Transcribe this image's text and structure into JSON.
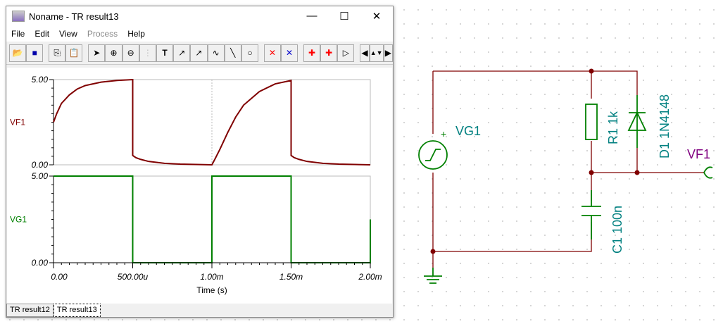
{
  "window": {
    "title": "Noname - TR result13",
    "min": "—",
    "max": "☐",
    "close": "✕"
  },
  "menu": [
    "File",
    "Edit",
    "View",
    "Process",
    "Help"
  ],
  "toolbar": [
    "open",
    "save",
    "copy",
    "paste",
    "pointer",
    "zoom-in",
    "zoom-out",
    "grid",
    "text",
    "cursor-a",
    "cursor-b",
    "wave",
    "line",
    "circle",
    "cursor-a-red",
    "cursor-b-blue",
    "add-curve",
    "add-probe",
    "arrow",
    "left",
    "up-down",
    "right"
  ],
  "tabs": [
    "TR result12",
    "TR result13"
  ],
  "chart_data": [
    {
      "type": "line",
      "title": "",
      "ylabel": "VF1",
      "xlabel": "Time (s)",
      "ylim": [
        0,
        5
      ],
      "xlim": [
        0,
        2
      ],
      "yticks": [
        "5.00",
        "0.00"
      ],
      "xticks": [
        "0.00",
        "500.00u",
        "1.00m",
        "1.50m",
        "2.00m"
      ],
      "color": "#800000",
      "x": [
        0,
        0.02,
        0.05,
        0.1,
        0.15,
        0.2,
        0.3,
        0.4,
        0.5,
        0.5,
        0.52,
        0.55,
        0.6,
        0.7,
        0.8,
        0.9,
        1.0,
        1.02,
        1.05,
        1.1,
        1.15,
        1.2,
        1.3,
        1.4,
        1.5,
        1.5,
        1.52,
        1.55,
        1.6,
        1.7,
        1.8,
        1.9,
        2.0
      ],
      "y": [
        2.5,
        3.0,
        3.6,
        4.1,
        4.45,
        4.65,
        4.85,
        4.95,
        5.0,
        0.55,
        0.42,
        0.32,
        0.2,
        0.09,
        0.04,
        0.02,
        0.0,
        0.35,
        0.9,
        1.9,
        2.8,
        3.5,
        4.3,
        4.75,
        4.95,
        0.55,
        0.42,
        0.32,
        0.2,
        0.09,
        0.04,
        0.02,
        0.0
      ]
    },
    {
      "type": "line",
      "title": "",
      "ylabel": "VG1",
      "xlabel": "Time (s)",
      "ylim": [
        0,
        5
      ],
      "xlim": [
        0,
        2
      ],
      "yticks": [
        "5.00",
        "0.00"
      ],
      "xticks": [
        "0.00",
        "500.00u",
        "1.00m",
        "1.50m",
        "2.00m"
      ],
      "color": "#008000",
      "x": [
        0,
        0.5,
        0.5,
        1.0,
        1.0,
        1.5,
        1.5,
        2.0,
        2.0
      ],
      "y": [
        5,
        5,
        0,
        0,
        5,
        5,
        0,
        0,
        2.5
      ]
    }
  ],
  "schematic": {
    "source": "VG1",
    "plus": "+",
    "resistor": "R1 1k",
    "diode": "D1 1N4148",
    "capacitor": "C1 100n",
    "output": "VF1"
  }
}
